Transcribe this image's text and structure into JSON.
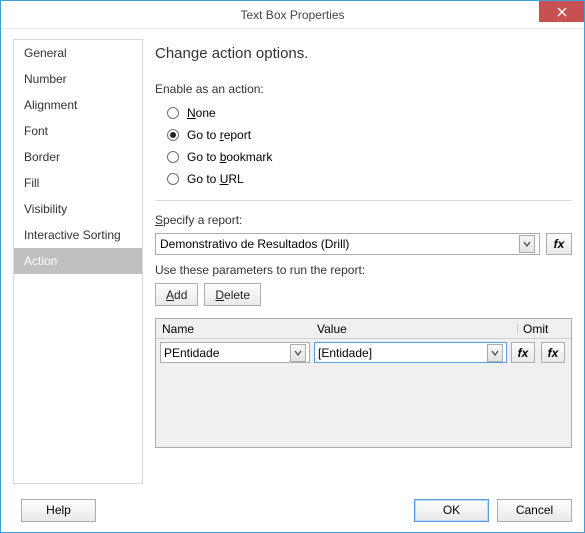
{
  "window": {
    "title": "Text Box Properties"
  },
  "sidebar": {
    "items": [
      {
        "label": "General"
      },
      {
        "label": "Number"
      },
      {
        "label": "Alignment"
      },
      {
        "label": "Font"
      },
      {
        "label": "Border"
      },
      {
        "label": "Fill"
      },
      {
        "label": "Visibility"
      },
      {
        "label": "Interactive Sorting"
      },
      {
        "label": "Action"
      }
    ],
    "selected_index": 8
  },
  "main": {
    "heading": "Change action options.",
    "enable_label": "Enable as an action:",
    "radios": {
      "none_pre": "",
      "none_u": "N",
      "none_post": "one",
      "report_pre": "Go to ",
      "report_u": "r",
      "report_post": "eport",
      "bookmark_pre": "Go to ",
      "bookmark_u": "b",
      "bookmark_post": "ookmark",
      "url_pre": "Go to ",
      "url_u": "U",
      "url_post": "RL",
      "selected": "report"
    },
    "specify_pre": "",
    "specify_u": "S",
    "specify_post": "pecify a report:",
    "report_combo": {
      "value": "Demonstrativo de Resultados (Drill)"
    },
    "fx_label": "fx",
    "params_label": "Use these parameters to run the report:",
    "add_u": "A",
    "add_post": "dd",
    "delete_u": "D",
    "delete_post": "elete",
    "grid": {
      "headers": {
        "name": "Name",
        "value": "Value",
        "omit": "Omit"
      },
      "rows": [
        {
          "name": "PEntidade",
          "value": "[Entidade]"
        }
      ]
    }
  },
  "footer": {
    "help": "Help",
    "ok": "OK",
    "cancel": "Cancel"
  }
}
